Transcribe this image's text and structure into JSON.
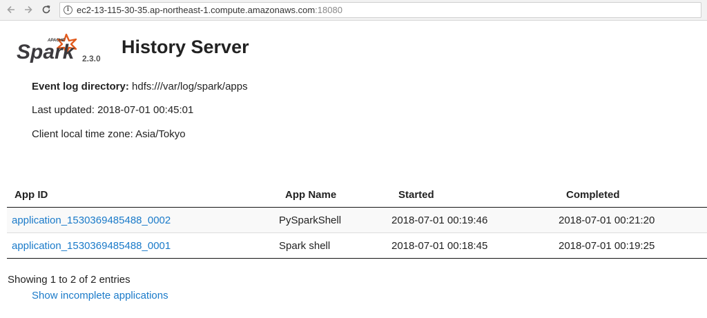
{
  "browser": {
    "url_host": "ec2-13-115-30-35.ap-northeast-1.compute.amazonaws.com",
    "url_port": ":18080",
    "back_icon": "back-arrow-icon",
    "forward_icon": "forward-arrow-icon",
    "reload_icon": "reload-icon",
    "info_icon": "info-icon"
  },
  "header": {
    "logo_small": "APACHE",
    "logo_text": "Spark",
    "version": "2.3.0",
    "title": "History Server"
  },
  "info": {
    "event_log_label": "Event log directory:",
    "event_log_value": "hdfs:///var/log/spark/apps",
    "last_updated": "Last updated: 2018-07-01 00:45:01",
    "time_zone": "Client local time zone: Asia/Tokyo"
  },
  "table": {
    "columns": [
      "App ID",
      "App Name",
      "Started",
      "Completed"
    ],
    "rows": [
      {
        "app_id": "application_1530369485488_0002",
        "app_name": "PySparkShell",
        "started": "2018-07-01 00:19:46",
        "completed": "2018-07-01 00:21:20"
      },
      {
        "app_id": "application_1530369485488_0001",
        "app_name": "Spark shell",
        "started": "2018-07-01 00:18:45",
        "completed": "2018-07-01 00:19:25"
      }
    ]
  },
  "footer": {
    "entries": "Showing 1 to 2 of 2 entries",
    "incomplete_link": "Show incomplete applications"
  },
  "colors": {
    "link": "#1a7ac9",
    "logo_orange": "#e25a1c"
  }
}
